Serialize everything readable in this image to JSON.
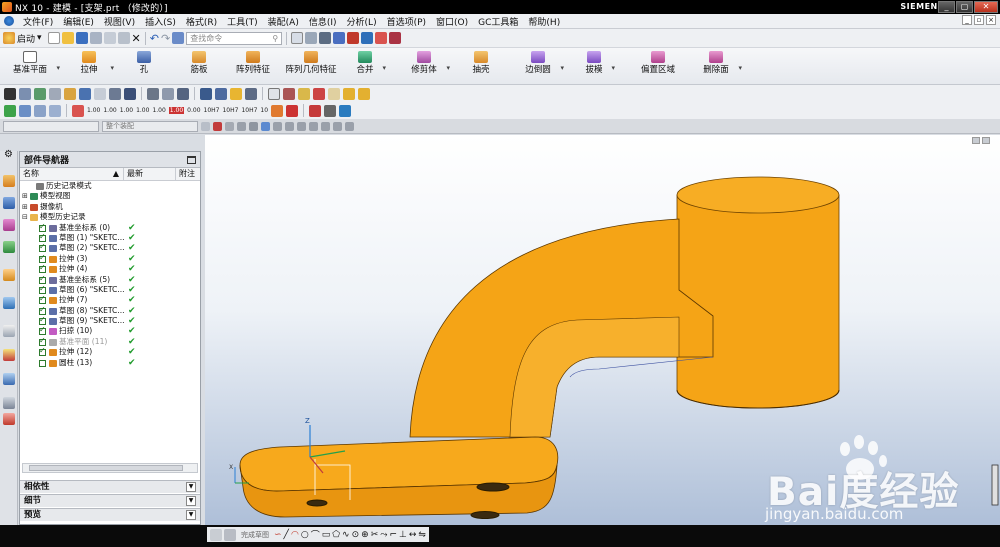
{
  "window": {
    "title": "NX 10 - 建模 - [支架.prt （修改的）]",
    "brand": "SIEMENS",
    "buttons": [
      "_",
      "▢",
      "✕"
    ]
  },
  "menu": {
    "items": [
      "文件(F)",
      "编辑(E)",
      "视图(V)",
      "插入(S)",
      "格式(R)",
      "工具(T)",
      "装配(A)",
      "信息(I)",
      "分析(L)",
      "首选项(P)",
      "窗口(O)",
      "GC工具箱",
      "帮助(H)"
    ]
  },
  "toolbar": {
    "start_label": "启动",
    "search_placeholder": "查找命令"
  },
  "ribbon": {
    "buttons": [
      "基准平面",
      "拉伸",
      "孔",
      "筋板",
      "阵列特征",
      "阵列几何特征",
      "合并",
      "修剪体",
      "抽壳",
      "边倒圆",
      "拔模",
      "偏置区域",
      "删除面"
    ]
  },
  "selection_bar": {
    "filter_value": "",
    "scope_value": "整个装配"
  },
  "navigator": {
    "title": "部件导航器",
    "columns": [
      "名称",
      "最新",
      "附注"
    ],
    "rows": [
      {
        "indent": 1,
        "label": "历史记录模式",
        "checkbox": false,
        "status": false,
        "color": "#7a7a7a",
        "expander": ""
      },
      {
        "indent": 0,
        "label": "模型视图",
        "checkbox": false,
        "status": false,
        "color": "#2e8b57",
        "expander": "+"
      },
      {
        "indent": 0,
        "label": "摄像机",
        "checkbox": false,
        "status": false,
        "color": "#c84b2b",
        "expander": "+"
      },
      {
        "indent": 0,
        "label": "模型历史记录",
        "checkbox": false,
        "status": false,
        "color": "#e9b44c",
        "expander": "−"
      },
      {
        "indent": 2,
        "label": "基准坐标系 (0)",
        "checkbox": true,
        "status": true,
        "color": "#6c6c9c",
        "expander": ""
      },
      {
        "indent": 2,
        "label": "草图 (1) \"SKETC...",
        "checkbox": true,
        "status": true,
        "color": "#5b6fa8",
        "expander": ""
      },
      {
        "indent": 2,
        "label": "草图 (2) \"SKETC...",
        "checkbox": true,
        "status": true,
        "color": "#5b6fa8",
        "expander": ""
      },
      {
        "indent": 2,
        "label": "拉伸 (3)",
        "checkbox": true,
        "status": true,
        "color": "#e08a1e",
        "expander": ""
      },
      {
        "indent": 2,
        "label": "拉伸 (4)",
        "checkbox": true,
        "status": true,
        "color": "#e08a1e",
        "expander": ""
      },
      {
        "indent": 2,
        "label": "基准坐标系 (5)",
        "checkbox": true,
        "status": true,
        "color": "#6c6c9c",
        "expander": ""
      },
      {
        "indent": 2,
        "label": "草图 (6) \"SKETC...",
        "checkbox": true,
        "status": true,
        "color": "#5b6fa8",
        "expander": ""
      },
      {
        "indent": 2,
        "label": "拉伸 (7)",
        "checkbox": true,
        "status": true,
        "color": "#e08a1e",
        "expander": ""
      },
      {
        "indent": 2,
        "label": "草图 (8) \"SKETC...",
        "checkbox": true,
        "status": true,
        "color": "#5b6fa8",
        "expander": ""
      },
      {
        "indent": 2,
        "label": "草图 (9) \"SKETC...",
        "checkbox": true,
        "status": true,
        "color": "#5b6fa8",
        "expander": ""
      },
      {
        "indent": 2,
        "label": "扫掠 (10)",
        "checkbox": true,
        "status": true,
        "color": "#c25bc2",
        "expander": ""
      },
      {
        "indent": 2,
        "label": "基准平面 (11)",
        "checkbox": true,
        "status": true,
        "color": "#aaaaaa",
        "expander": "",
        "grey": true
      },
      {
        "indent": 2,
        "label": "拉伸 (12)",
        "checkbox": true,
        "status": true,
        "color": "#e08a1e",
        "expander": ""
      },
      {
        "indent": 2,
        "label": "圆柱 (13)",
        "checkbox": false,
        "status": true,
        "color": "#e08a1e",
        "expander": ""
      }
    ],
    "panels": [
      "相依性",
      "细节",
      "预览"
    ]
  },
  "viewport": {
    "part_color": "#f5a416",
    "watermark": "Bai度经验",
    "watermark_url": "jingyan.baidu.com",
    "axis_labels": [
      "Z",
      "X",
      "Y"
    ]
  },
  "sketch_toolbar": {
    "finish_label": "完成草图"
  }
}
